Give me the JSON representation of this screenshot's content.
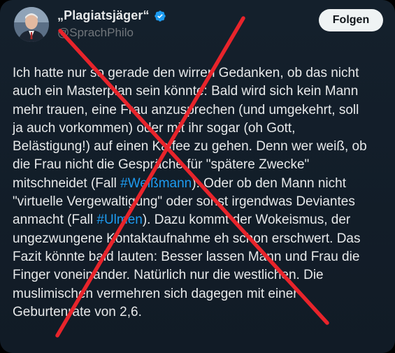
{
  "author": {
    "display_name": "„Plagiatsjäger“",
    "handle": "@SprachPhilo",
    "verified": true,
    "verified_color": "#1d9bf0"
  },
  "follow_button": {
    "label": "Folgen"
  },
  "tweet": {
    "lines": [
      [
        {
          "t": "Ich hatte nur so gerade den wirren Gedanken, ob das nicht"
        }
      ],
      [
        {
          "t": "auch ein Masterplan sein könnte: Bald wird sich kein Mann"
        }
      ],
      [
        {
          "t": "mehr trauen, eine Frau anzusprechen (und umgekehrt, soll"
        }
      ],
      [
        {
          "t": "ja auch vorkommen) oder mit ihr sogar (oh Gott,"
        }
      ],
      [
        {
          "t": "Belästigung!) auf einen Kaffee zu gehen. Denn wer weiß, ob"
        }
      ],
      [
        {
          "t": "die Frau nicht die Gespräche für \"spätere Zwecke\""
        }
      ],
      [
        {
          "t": "mitschneidet (Fall "
        },
        {
          "t": "#Weißmann",
          "tag": true
        },
        {
          "t": "). Oder ob den Mann nicht"
        }
      ],
      [
        {
          "t": "\"virtuelle Vergewaltigung\" oder sonst irgendwas Deviantes"
        }
      ],
      [
        {
          "t": "anmacht (Fall "
        },
        {
          "t": "#Ulmen",
          "tag": true
        },
        {
          "t": "). Dazu kommt der Wokeismus, der"
        }
      ],
      [
        {
          "t": "ungezwungene Kontaktaufnahme eh schon erschwert. Das"
        }
      ],
      [
        {
          "t": "Fazit könnte bald lauten: Besser lassen Mann und Frau die"
        }
      ],
      [
        {
          "t": "Finger voneinander. Natürlich nur die westlichen. Die"
        }
      ],
      [
        {
          "t": "muslimischen vermehren sich dagegen mit einer"
        }
      ],
      [
        {
          "t": "Geburtenrate von 2,6."
        }
      ]
    ]
  },
  "overlay": {
    "icon": "red-x-cross-icon",
    "color": "#e8242b"
  },
  "colors": {
    "background": "#15202b",
    "text": "#e7e9ea",
    "muted": "#71767b",
    "hashtag": "#1d9bf0"
  }
}
